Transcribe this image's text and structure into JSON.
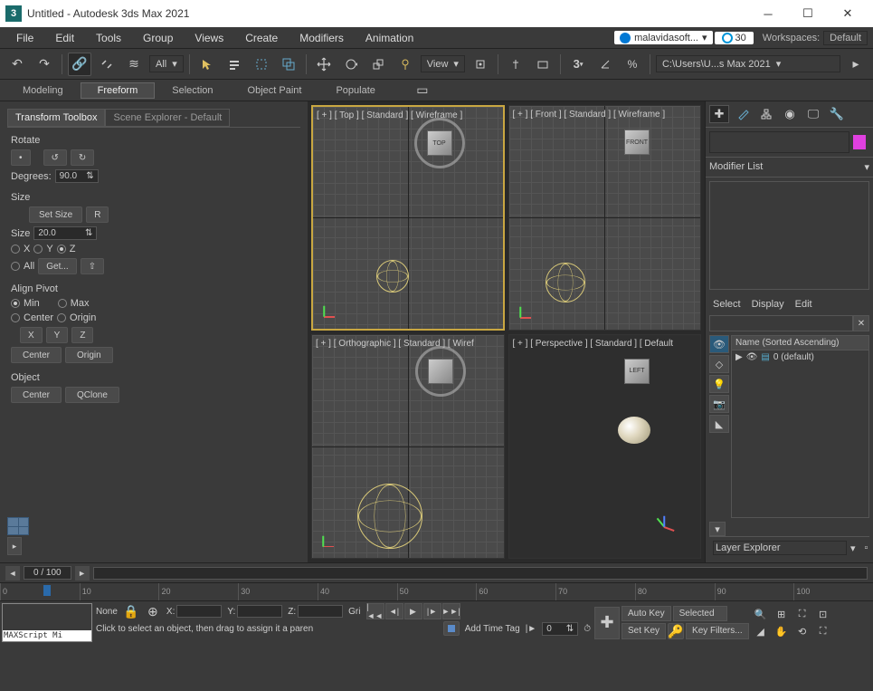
{
  "titlebar": {
    "app_icon": "3",
    "title": "Untitled - Autodesk 3ds Max 2021"
  },
  "menu": {
    "items": [
      "File",
      "Edit",
      "Tools",
      "Group",
      "Views",
      "Create",
      "Modifiers",
      "Animation"
    ],
    "account": "malavidasoft...",
    "timer": "30",
    "workspaces_label": "Workspaces:",
    "workspaces_value": "Default"
  },
  "toolbar": {
    "all_label": "All",
    "view_label": "View",
    "path_label": "C:\\Users\\U...s Max 2021"
  },
  "ribbon": {
    "tabs": [
      "Modeling",
      "Freeform",
      "Selection",
      "Object Paint",
      "Populate"
    ]
  },
  "left": {
    "tab_active": "Transform Toolbox",
    "tab_inactive": "Scene Explorer - Default",
    "rotate": {
      "label": "Rotate",
      "degrees_label": "Degrees:",
      "degrees_value": "90.0"
    },
    "size": {
      "label": "Size",
      "setsize": "Set Size",
      "r": "R",
      "size_label": "Size",
      "size_value": "20.0",
      "x": "X",
      "y": "Y",
      "z": "Z",
      "all": "All",
      "get": "Get..."
    },
    "align": {
      "label": "Align Pivot",
      "min": "Min",
      "max": "Max",
      "center": "Center",
      "origin": "Origin",
      "x": "X",
      "y": "Y",
      "z": "Z",
      "center2": "Center",
      "origin2": "Origin"
    },
    "object": {
      "label": "Object",
      "center": "Center",
      "qclone": "QClone"
    }
  },
  "viewports": {
    "top": "[ + ] [ Top ] [ Standard ] [ Wireframe ]",
    "front": "[ + ] [ Front ] [ Standard ] [ Wireframe ]",
    "ortho": "[ + ] [ Orthographic ] [ Standard ] [ Wiref",
    "persp": "[ + ] [ Perspective ] [ Standard ] [ Default",
    "cube_top": "TOP",
    "cube_front": "FRONT",
    "cube_left": "LEFT"
  },
  "right": {
    "modifier_list": "Modifier List",
    "scene_tabs": {
      "select": "Select",
      "display": "Display",
      "edit": "Edit"
    },
    "name_header": "Name (Sorted Ascending)",
    "default_layer": "0 (default)",
    "layer_explorer": "Layer Explorer"
  },
  "timeline": {
    "frame": "0 / 100",
    "ticks": [
      "0",
      "10",
      "20",
      "30",
      "40",
      "50",
      "60",
      "70",
      "80",
      "90",
      "100"
    ]
  },
  "status": {
    "maxscript": "MAXScript Mi",
    "none": "None",
    "x": "X:",
    "y": "Y:",
    "z": "Z:",
    "grid": "Gri",
    "prompt": "Click to select an object, then drag to assign it a paren",
    "add_time_tag": "Add Time Tag",
    "frame_value": "0",
    "autokey": "Auto Key",
    "selected": "Selected",
    "setkey": "Set Key",
    "keyfilters": "Key Filters..."
  }
}
